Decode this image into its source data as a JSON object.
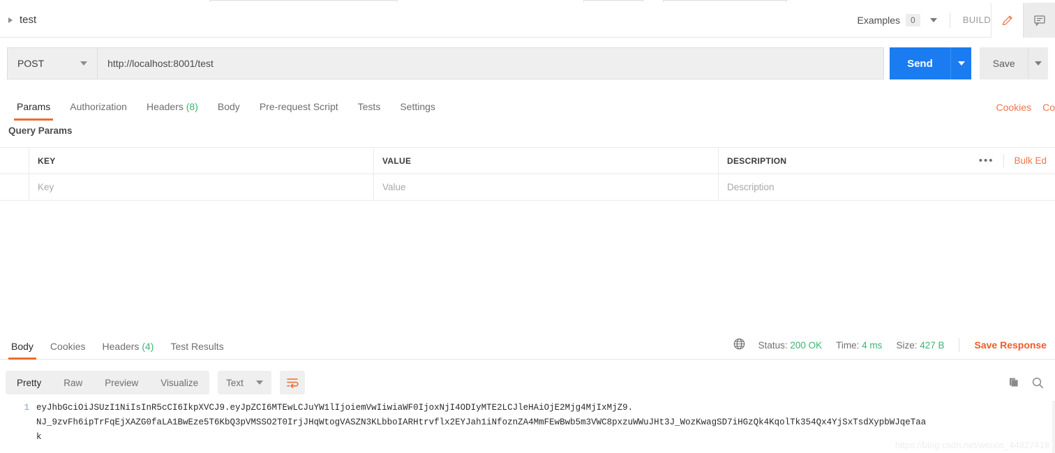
{
  "request": {
    "name": "test",
    "expander_icon": "triangle-right-icon",
    "examples_label": "Examples",
    "examples_count": "0",
    "build_label": "BUILD",
    "edit_icon": "pencil-icon",
    "comment_icon": "comment-icon",
    "method": "POST",
    "url": "http://localhost:8001/test",
    "send_label": "Send",
    "save_label": "Save",
    "tabs": [
      {
        "label": "Params",
        "count": "",
        "active": true
      },
      {
        "label": "Authorization",
        "count": "",
        "active": false
      },
      {
        "label": "Headers",
        "count": "(8)",
        "active": false
      },
      {
        "label": "Body",
        "count": "",
        "active": false
      },
      {
        "label": "Pre-request Script",
        "count": "",
        "active": false
      },
      {
        "label": "Tests",
        "count": "",
        "active": false
      },
      {
        "label": "Settings",
        "count": "",
        "active": false
      }
    ],
    "links": [
      {
        "label": "Cookies"
      },
      {
        "label": "Co"
      }
    ]
  },
  "params": {
    "section_title": "Query Params",
    "columns": [
      "KEY",
      "VALUE",
      "DESCRIPTION"
    ],
    "placeholders": {
      "key": "Key",
      "value": "Value",
      "description": "Description"
    },
    "more_icon": "ellipsis-icon",
    "bulk_edit_label": "Bulk Ed"
  },
  "response": {
    "tabs": [
      {
        "label": "Body",
        "count": "",
        "active": true
      },
      {
        "label": "Cookies",
        "count": "",
        "active": false
      },
      {
        "label": "Headers",
        "count": "(4)",
        "active": false
      },
      {
        "label": "Test Results",
        "count": "",
        "active": false
      }
    ],
    "globe_icon": "globe-icon",
    "status_label": "Status:",
    "status_value": "200 OK",
    "time_label": "Time:",
    "time_value": "4 ms",
    "size_label": "Size:",
    "size_value": "427 B",
    "save_response_label": "Save Response",
    "view_modes": [
      {
        "label": "Pretty",
        "active": true
      },
      {
        "label": "Raw",
        "active": false
      },
      {
        "label": "Preview",
        "active": false
      },
      {
        "label": "Visualize",
        "active": false
      }
    ],
    "format": "Text",
    "wrap_icon": "word-wrap-icon",
    "copy_icon": "copy-icon",
    "search_icon": "search-icon",
    "body_lines": [
      {
        "num": "1",
        "text": "eyJhbGciOiJSUzI1NiIsInR5cCI6IkpXVCJ9.eyJpZCI6MTEwLCJuYW1lIjoiemVwIiwiaWF0IjoxNjI4ODIyMTE2LCJleHAiOjE2Mjg4MjIxMjZ9."
      },
      {
        "num": "",
        "text": "NJ_9zvFh6ipTrFqEjXAZG0faLA1BwEze5T6KbQ3pVMSSO2T0IrjJHqWtogVASZN3KLbboIARHtrvflx2EYJah1iNfoznZA4MmFEwBwb5m3VWC8pxzuWWuJHt3J_WozKwagSD7iHGzQk4KqolTk354Qx4YjSxTsdXypbWJqeTaa"
      },
      {
        "num": "",
        "text": "k"
      }
    ],
    "watermark": "https://blog.csdn.net/weixin_44827418"
  },
  "colors": {
    "accent_orange": "#ef6c2e",
    "send_blue": "#1a7cf0",
    "count_green": "#3cb371",
    "link_orange": "#f0744a"
  }
}
